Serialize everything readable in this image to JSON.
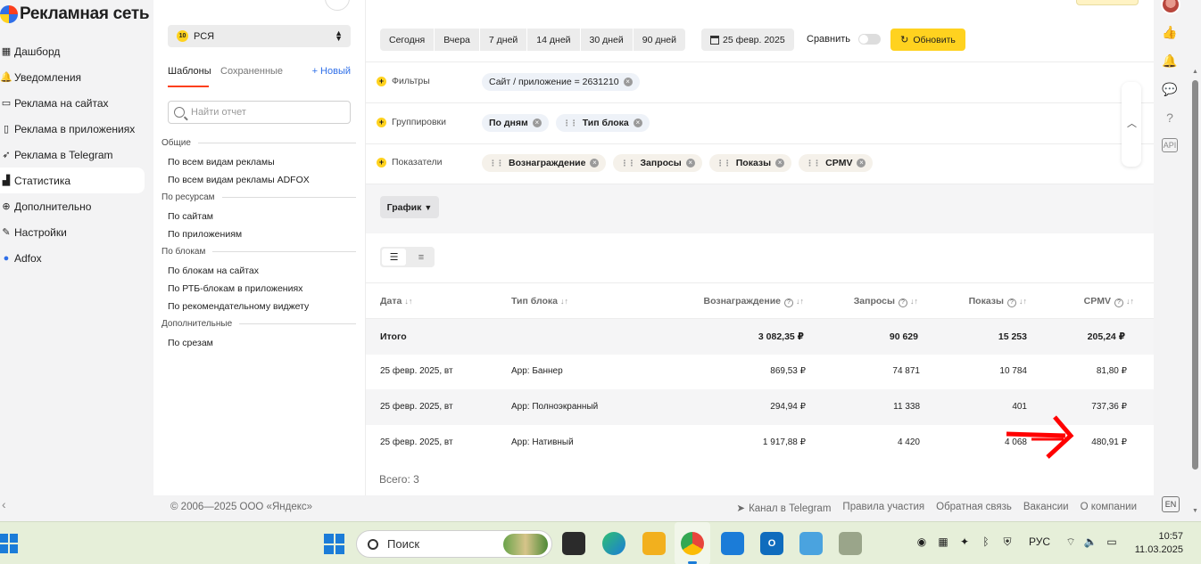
{
  "brand": {
    "title": "Рекламная сеть"
  },
  "nav": {
    "items": [
      {
        "label": "Дашборд",
        "icon": "grid-icon",
        "active": false
      },
      {
        "label": "Уведомления",
        "icon": "bell-icon",
        "active": false
      },
      {
        "label": "Реклама на сайтах",
        "icon": "monitor-icon",
        "active": false
      },
      {
        "label": "Реклама в приложениях",
        "icon": "phone-icon",
        "active": false
      },
      {
        "label": "Реклама в Telegram",
        "icon": "telegram-icon",
        "active": false
      },
      {
        "label": "Статистика",
        "icon": "bar-chart-icon",
        "active": true
      },
      {
        "label": "Дополнительно",
        "icon": "plus-circle-icon",
        "active": false
      },
      {
        "label": "Настройки",
        "icon": "wrench-icon",
        "active": false
      },
      {
        "label": "Adfox",
        "icon": "adfox-icon",
        "active": false
      }
    ]
  },
  "sidebar": {
    "product_select": {
      "badge": "10",
      "label": "РСЯ"
    },
    "tabs": {
      "templates": "Шаблоны",
      "saved": "Сохраненные",
      "new": "+ Новый"
    },
    "search_placeholder": "Найти отчет",
    "groups": [
      {
        "title": "Общие",
        "items": [
          "По всем видам рекламы",
          "По всем видам рекламы ADFOX"
        ]
      },
      {
        "title": "По ресурсам",
        "items": [
          "По сайтам",
          "По приложениям"
        ]
      },
      {
        "title": "По блокам",
        "items": [
          "По блокам на сайтах",
          "По РТБ-блокам в приложениях",
          "По рекомендательному виджету"
        ]
      },
      {
        "title": "Дополнительные",
        "items": [
          "По срезам"
        ]
      }
    ]
  },
  "toolbar": {
    "periods": [
      "Сегодня",
      "Вчера",
      "7 дней",
      "14 дней",
      "30 дней",
      "90 дней"
    ],
    "date": "25 февр. 2025",
    "compare_label": "Сравнить",
    "refresh_label": "Обновить"
  },
  "filters": {
    "filters_label": "Фильтры",
    "filter_chips": [
      "Сайт / приложение = 2631210"
    ],
    "groupings_label": "Группировки",
    "grouping_chips": [
      "По дням",
      "Тип блока"
    ],
    "metrics_label": "Показатели",
    "metric_chips": [
      "Вознаграждение",
      "Запросы",
      "Показы",
      "CPMV"
    ]
  },
  "chart_toggle_label": "График",
  "table": {
    "columns": [
      "Дата",
      "Тип блока",
      "Вознаграждение",
      "Запросы",
      "Показы",
      "CPMV"
    ],
    "total": {
      "label": "Итого",
      "reward": "3 082,35 ₽",
      "requests": "90 629",
      "shows": "15 253",
      "cpmv": "205,24 ₽"
    },
    "rows": [
      {
        "date": "25 февр. 2025, вт",
        "type": "App: Баннер",
        "reward": "869,53 ₽",
        "requests": "74 871",
        "shows": "10 784",
        "cpmv": "81,80 ₽"
      },
      {
        "date": "25 февр. 2025, вт",
        "type": "App: Полноэкранный",
        "reward": "294,94 ₽",
        "requests": "11 338",
        "shows": "401",
        "cpmv": "737,36 ₽"
      },
      {
        "date": "25 февр. 2025, вт",
        "type": "App: Нативный",
        "reward": "1 917,88 ₽",
        "requests": "4 420",
        "shows": "4 068",
        "cpmv": "480,91 ₽"
      }
    ],
    "count": "Всего: 3"
  },
  "footer": {
    "copyright": "© 2006—2025 ООО «Яндекс»",
    "links": [
      "Канал в Telegram",
      "Правила участия",
      "Обратная связь",
      "Вакансии",
      "О компании"
    ]
  },
  "rail": {
    "lang": "EN",
    "api": "API"
  },
  "taskbar": {
    "search_label": "Поиск",
    "lang": "РУС",
    "time": "10:57",
    "date": "11.03.2025"
  },
  "colors": {
    "accent": "#ffd21f",
    "tab_underline": "#fc3f1d",
    "link": "#2f6fe8",
    "annotation_arrow": "#ff0000"
  }
}
